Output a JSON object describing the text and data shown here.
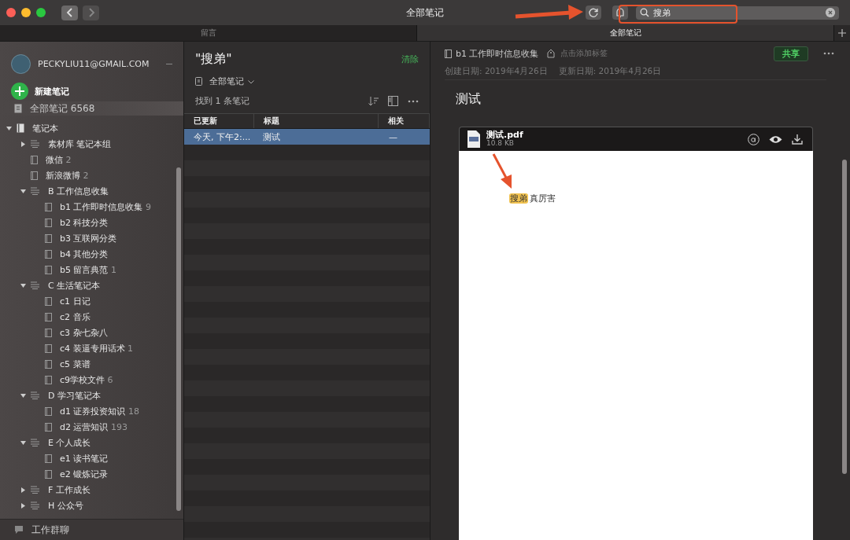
{
  "window": {
    "title": "全部笔记"
  },
  "toolbar": {
    "search": {
      "value": "搜弟"
    }
  },
  "tabs": [
    {
      "label": "留言",
      "selected": false
    },
    {
      "label": "全部笔记",
      "selected": true
    }
  ],
  "sidebar": {
    "account": "PECKYLIU11@GMAIL.COM",
    "new_note": "新建笔记",
    "all_notes": {
      "label": "全部笔记",
      "count": "6568"
    },
    "tree": [
      {
        "label": "笔记本",
        "kind": "root",
        "expanded": true,
        "children": [
          {
            "label": "素材库 笔记本组",
            "kind": "stack",
            "expanded": false
          },
          {
            "label": "微信",
            "count": "2",
            "kind": "notebook"
          },
          {
            "label": "新浪微博",
            "count": "2",
            "kind": "notebook"
          },
          {
            "label": "B 工作信息收集",
            "kind": "stack",
            "expanded": true,
            "children": [
              {
                "label": "b1 工作即时信息收集",
                "count": "9",
                "kind": "notebook"
              },
              {
                "label": "b2 科技分类",
                "kind": "notebook"
              },
              {
                "label": "b3 互联网分类",
                "kind": "notebook"
              },
              {
                "label": "b4 其他分类",
                "kind": "notebook"
              },
              {
                "label": "b5 留言典范",
                "count": "1",
                "kind": "notebook"
              }
            ]
          },
          {
            "label": "C 生活笔记本",
            "kind": "stack",
            "expanded": true,
            "children": [
              {
                "label": "c1 日记",
                "kind": "notebook"
              },
              {
                "label": "c2 音乐",
                "kind": "notebook"
              },
              {
                "label": "c3 杂七杂八",
                "kind": "notebook"
              },
              {
                "label": "c4 装逼专用话术",
                "count": "1",
                "kind": "notebook"
              },
              {
                "label": "c5 菜谱",
                "kind": "notebook"
              },
              {
                "label": "c9学校文件",
                "count": "6",
                "kind": "notebook"
              }
            ]
          },
          {
            "label": "D 学习笔记本",
            "kind": "stack",
            "expanded": true,
            "children": [
              {
                "label": "d1 证券投资知识",
                "count": "18",
                "kind": "notebook"
              },
              {
                "label": "d2 运营知识",
                "count": "193",
                "kind": "notebook"
              }
            ]
          },
          {
            "label": "E 个人成长",
            "kind": "stack",
            "expanded": true,
            "children": [
              {
                "label": "e1 读书笔记",
                "kind": "notebook"
              },
              {
                "label": "e2 锻炼记录",
                "kind": "notebook"
              }
            ]
          },
          {
            "label": "F 工作成长",
            "kind": "stack",
            "expanded": false
          },
          {
            "label": "H 公众号",
            "kind": "stack",
            "expanded": false
          }
        ]
      }
    ],
    "footer": "工作群聊"
  },
  "note_list": {
    "query": "\"搜弟\"",
    "clear": "清除",
    "scope": "全部笔记",
    "result_count": "找到 1 条笔记",
    "columns": [
      "已更新",
      "标题",
      "相关"
    ],
    "rows": [
      {
        "updated": "今天, 下午2:...",
        "title": "测试",
        "relevance": "—",
        "selected": true
      }
    ]
  },
  "note": {
    "notebook": "b1 工作即时信息收集",
    "tag_placeholder": "点击添加标签",
    "share": "共享",
    "created": "创建日期: 2019年4月26日",
    "updated": "更新日期: 2019年4月26日",
    "title": "测试",
    "attachment": {
      "name": "测试.pdf",
      "size": "10.8 KB",
      "highlight": "搜弟",
      "text": "真厉害"
    }
  }
}
